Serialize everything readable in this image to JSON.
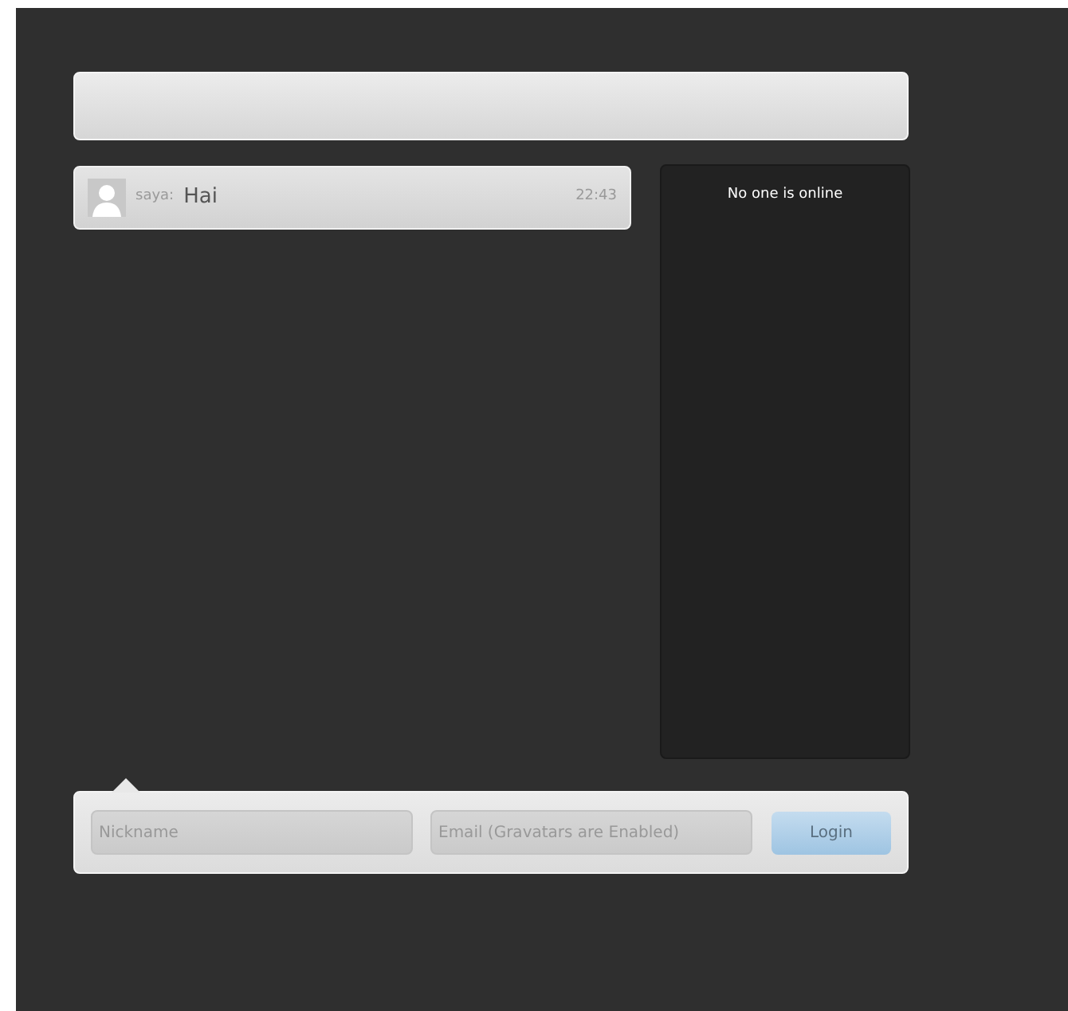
{
  "messages": [
    {
      "author": "saya:",
      "text": "Hai",
      "time": "22:43"
    }
  ],
  "online_panel": {
    "status": "No one is online"
  },
  "login_bar": {
    "nickname": {
      "placeholder": "Nickname"
    },
    "email": {
      "placeholder": "Email (Gravatars are Enabled)"
    },
    "button": "Login"
  }
}
